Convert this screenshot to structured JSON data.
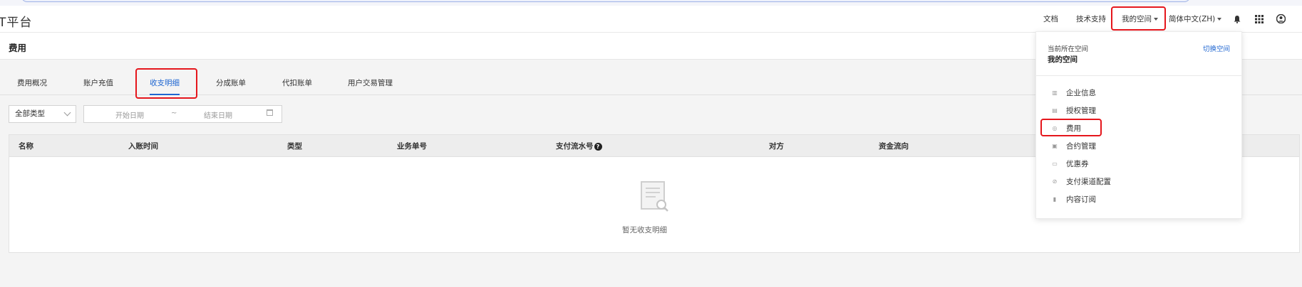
{
  "header": {
    "logo_text": "T平台",
    "nav": {
      "docs": "文档",
      "support": "技术支持",
      "my_space": "我的空间",
      "language": "简体中文(ZH)"
    },
    "icons": [
      "bell-icon",
      "apps-grid-icon",
      "user-icon"
    ]
  },
  "page": {
    "title": "费用"
  },
  "tabs": [
    {
      "label": "费用概况",
      "active": false
    },
    {
      "label": "账户充值",
      "active": false
    },
    {
      "label": "收支明细",
      "active": true
    },
    {
      "label": "分成账单",
      "active": false
    },
    {
      "label": "代扣账单",
      "active": false
    },
    {
      "label": "用户交易管理",
      "active": false
    }
  ],
  "filters": {
    "type_select": "全部类型",
    "start_placeholder": "开始日期",
    "separator": "~",
    "end_placeholder": "结束日期"
  },
  "table": {
    "columns": [
      "名称",
      "入账时间",
      "类型",
      "业务单号",
      "支付流水号",
      "对方",
      "资金流向"
    ],
    "help_icon": "?",
    "empty_text": "暂无收支明细"
  },
  "dropdown": {
    "current_label": "当前所在空间",
    "current_value": "我的空间",
    "switch_label": "切换空间",
    "items": [
      {
        "label": "企业信息",
        "icon": "building-icon"
      },
      {
        "label": "授权管理",
        "icon": "auth-icon"
      },
      {
        "label": "费用",
        "icon": "coin-icon"
      },
      {
        "label": "合约管理",
        "icon": "contract-icon"
      },
      {
        "label": "优惠券",
        "icon": "coupon-icon"
      },
      {
        "label": "支付渠道配置",
        "icon": "payment-channel-icon"
      },
      {
        "label": "内容订阅",
        "icon": "bookmark-icon"
      }
    ]
  },
  "colors": {
    "accent": "#1f66d1",
    "annotation": "#e5161c"
  }
}
